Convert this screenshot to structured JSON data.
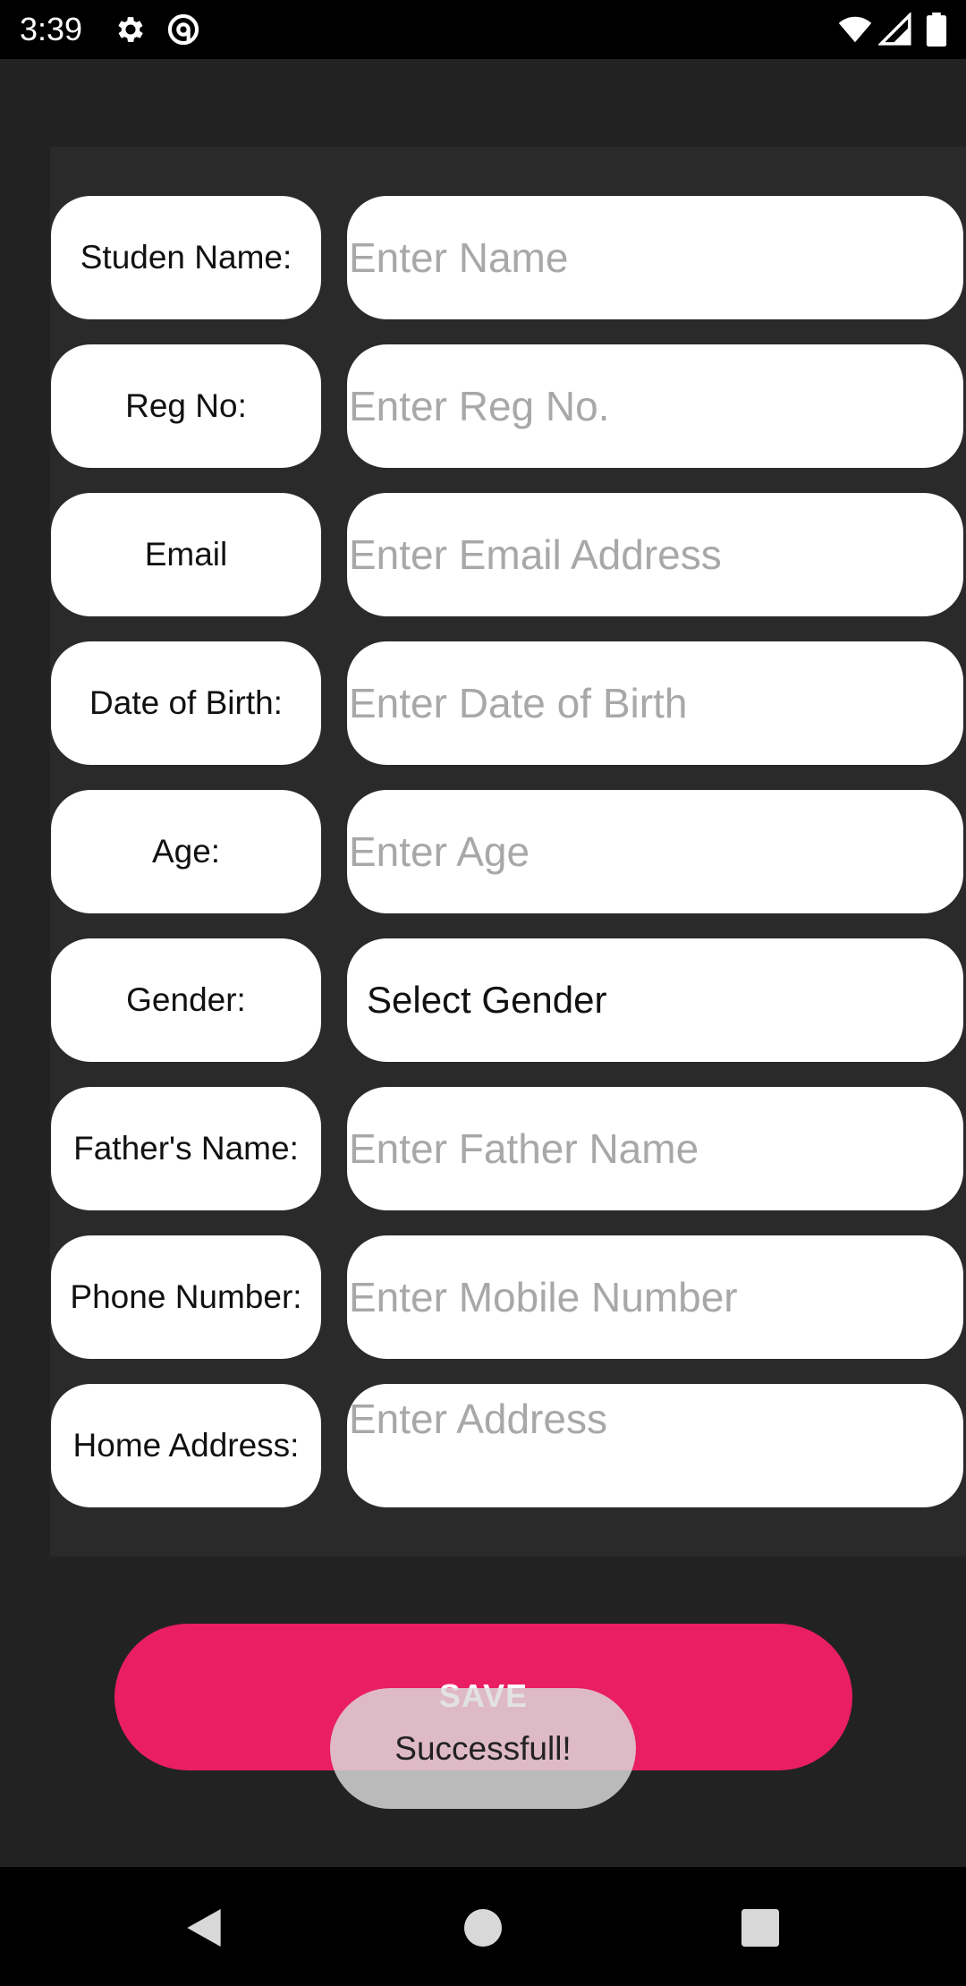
{
  "status_bar": {
    "time": "3:39",
    "icons": [
      "gear-icon",
      "at-sign-icon",
      "wifi-icon",
      "signal-icon",
      "battery-icon"
    ]
  },
  "form": {
    "student_name": {
      "label": "Studen Name:",
      "placeholder": "Enter Name"
    },
    "reg_no": {
      "label": "Reg No:",
      "placeholder": "Enter Reg No."
    },
    "email": {
      "label": "Email",
      "placeholder": "Enter Email Address"
    },
    "dob": {
      "label": "Date of Birth:",
      "placeholder": "Enter Date of Birth"
    },
    "age": {
      "label": "Age:",
      "placeholder": "Enter Age"
    },
    "gender": {
      "label": "Gender:",
      "selected": "Select Gender"
    },
    "father_name": {
      "label": "Father's Name:",
      "placeholder": "Enter Father Name"
    },
    "phone": {
      "label": "Phone Number:",
      "placeholder": "Enter Mobile Number"
    },
    "address": {
      "label": "Home Address:",
      "placeholder": "Enter Address"
    }
  },
  "save_button": {
    "label": "SAVE"
  },
  "toast": {
    "message": "Successfull!"
  },
  "nav_bar": {
    "icons": [
      "back-icon",
      "home-icon",
      "recents-icon"
    ]
  },
  "colors": {
    "accent": "#e91e63",
    "background": "#222222",
    "panel": "#2a2a2a",
    "placeholder": "#a8a8a8"
  }
}
